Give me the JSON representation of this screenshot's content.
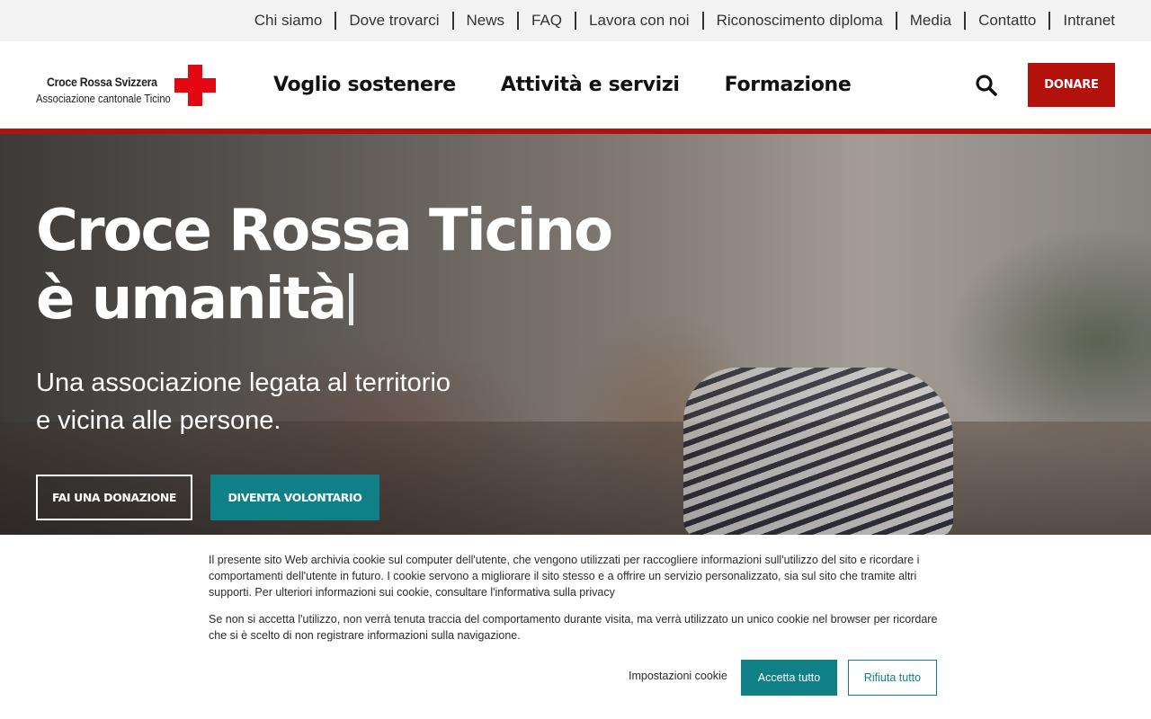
{
  "topnav": {
    "items": [
      {
        "label": "Chi siamo"
      },
      {
        "label": "Dove trovarci"
      },
      {
        "label": "News"
      },
      {
        "label": "FAQ"
      },
      {
        "label": "Lavora con noi"
      },
      {
        "label": "Riconoscimento diploma"
      },
      {
        "label": "Media"
      },
      {
        "label": "Contatto"
      },
      {
        "label": "Intranet"
      }
    ]
  },
  "logo": {
    "line1": "Croce Rossa Svizzera",
    "line2": "Associazione cantonale Ticino"
  },
  "mainnav": {
    "items": [
      {
        "label": "Voglio sostenere"
      },
      {
        "label": "Attività e servizi"
      },
      {
        "label": "Formazione"
      }
    ]
  },
  "header": {
    "search_icon": "search-icon",
    "donate_label": "DONARE"
  },
  "hero": {
    "title_line1": "Croce Rossa Ticino",
    "title_line2": "è umanità",
    "subtitle": "Una associazione legata al territorio e vicina alle persone.",
    "donate_button": "FAI UNA DONAZIONE",
    "volunteer_button": "DIVENTA VOLONTARIO"
  },
  "cookie": {
    "text1": "Il presente sito Web archivia cookie sul computer dell'utente, che vengono utilizzati per raccogliere informazioni sull'utilizzo del sito e ricordare i comportamenti dell'utente in futuro. I cookie servono a migliorare il sito stesso e a offrire un servizio personalizzato, sia sul sito che tramite altri supporti. Per ulteriori informazioni sui cookie, consultare l'informativa sulla privacy",
    "text2": "Se non si accetta l'utilizzo, non verrà tenuta traccia del comportamento durante visita, ma verrà utilizzato un unico cookie nel browser per ricordare che si è scelto di non registrare informazioni sulla navigazione.",
    "settings_label": "Impostazioni cookie",
    "accept_label": "Accetta tutto",
    "reject_label": "Rifiuta tutto"
  },
  "colors": {
    "brand_red": "#b3110c",
    "cross_red": "#e30613",
    "teal": "#0f8186"
  }
}
